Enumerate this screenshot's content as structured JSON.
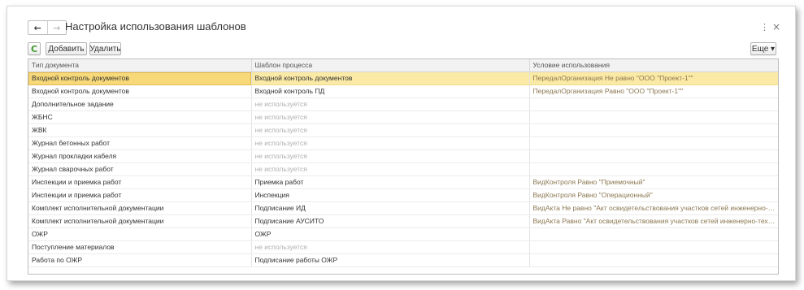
{
  "window": {
    "title": "Настройка использования шаблонов",
    "nav_back": "←",
    "nav_forward": "→",
    "menu_glyph": "⋮",
    "close_glyph": "×"
  },
  "toolbar": {
    "refresh_glyph": "C",
    "add_label": "Добавить",
    "delete_label": "Удалить",
    "more_label": "Еще ▾"
  },
  "table": {
    "columns": [
      "Тип документа",
      "Шаблон процесса",
      "Условие использования"
    ],
    "rows": [
      {
        "doc_type": "Входной контроль документов",
        "template": "Входной контроль документов",
        "condition": "ПередалОрганизация Не равно \"ООО \"Проект-1\"\""
      },
      {
        "doc_type": "Входной контроль документов",
        "template": "Входной контроль ПД",
        "condition": "ПередалОрганизация Равно \"ООО \"Проект-1\"\""
      },
      {
        "doc_type": "Дополнительное задание",
        "template": "не используется",
        "condition": ""
      },
      {
        "doc_type": "ЖБНС",
        "template": "не используется",
        "condition": ""
      },
      {
        "doc_type": "ЖВК",
        "template": "не используется",
        "condition": ""
      },
      {
        "doc_type": "Журнал бетонных работ",
        "template": "не используется",
        "condition": ""
      },
      {
        "doc_type": "Журнал прокладки кабеля",
        "template": "не используется",
        "condition": ""
      },
      {
        "doc_type": "Журнал сварочных работ",
        "template": "не используется",
        "condition": ""
      },
      {
        "doc_type": "Инспекции и приемка работ",
        "template": "Приемка работ",
        "condition": "ВидКонтроля Равно \"Приемочный\""
      },
      {
        "doc_type": "Инспекции и приемка работ",
        "template": "Инспекция",
        "condition": "ВидКонтроля Равно \"Операционный\""
      },
      {
        "doc_type": "Комплект исполнительной документации",
        "template": "Подписание ИД",
        "condition": "ВидАкта Не равно \"Акт освидетельствования участков сетей инженерно-техническог..."
      },
      {
        "doc_type": "Комплект исполнительной документации",
        "template": "Подписание АУСИТО",
        "condition": "ВидАкта Равно \"Акт освидетельствования участков сетей инженерно-технического о..."
      },
      {
        "doc_type": "ОЖР",
        "template": "ОЖР",
        "condition": ""
      },
      {
        "doc_type": "Поступление материалов",
        "template": "не используется",
        "condition": ""
      },
      {
        "doc_type": "Работа по ОЖР",
        "template": "Подписание работы ОЖР",
        "condition": ""
      }
    ]
  },
  "colors": {
    "selected_row": "#fbeaa6",
    "selected_cell": "#f7d97a",
    "muted_text": "#b0b0b0",
    "condition_text": "#8b7750",
    "refresh_icon": "#3d9a2c"
  }
}
